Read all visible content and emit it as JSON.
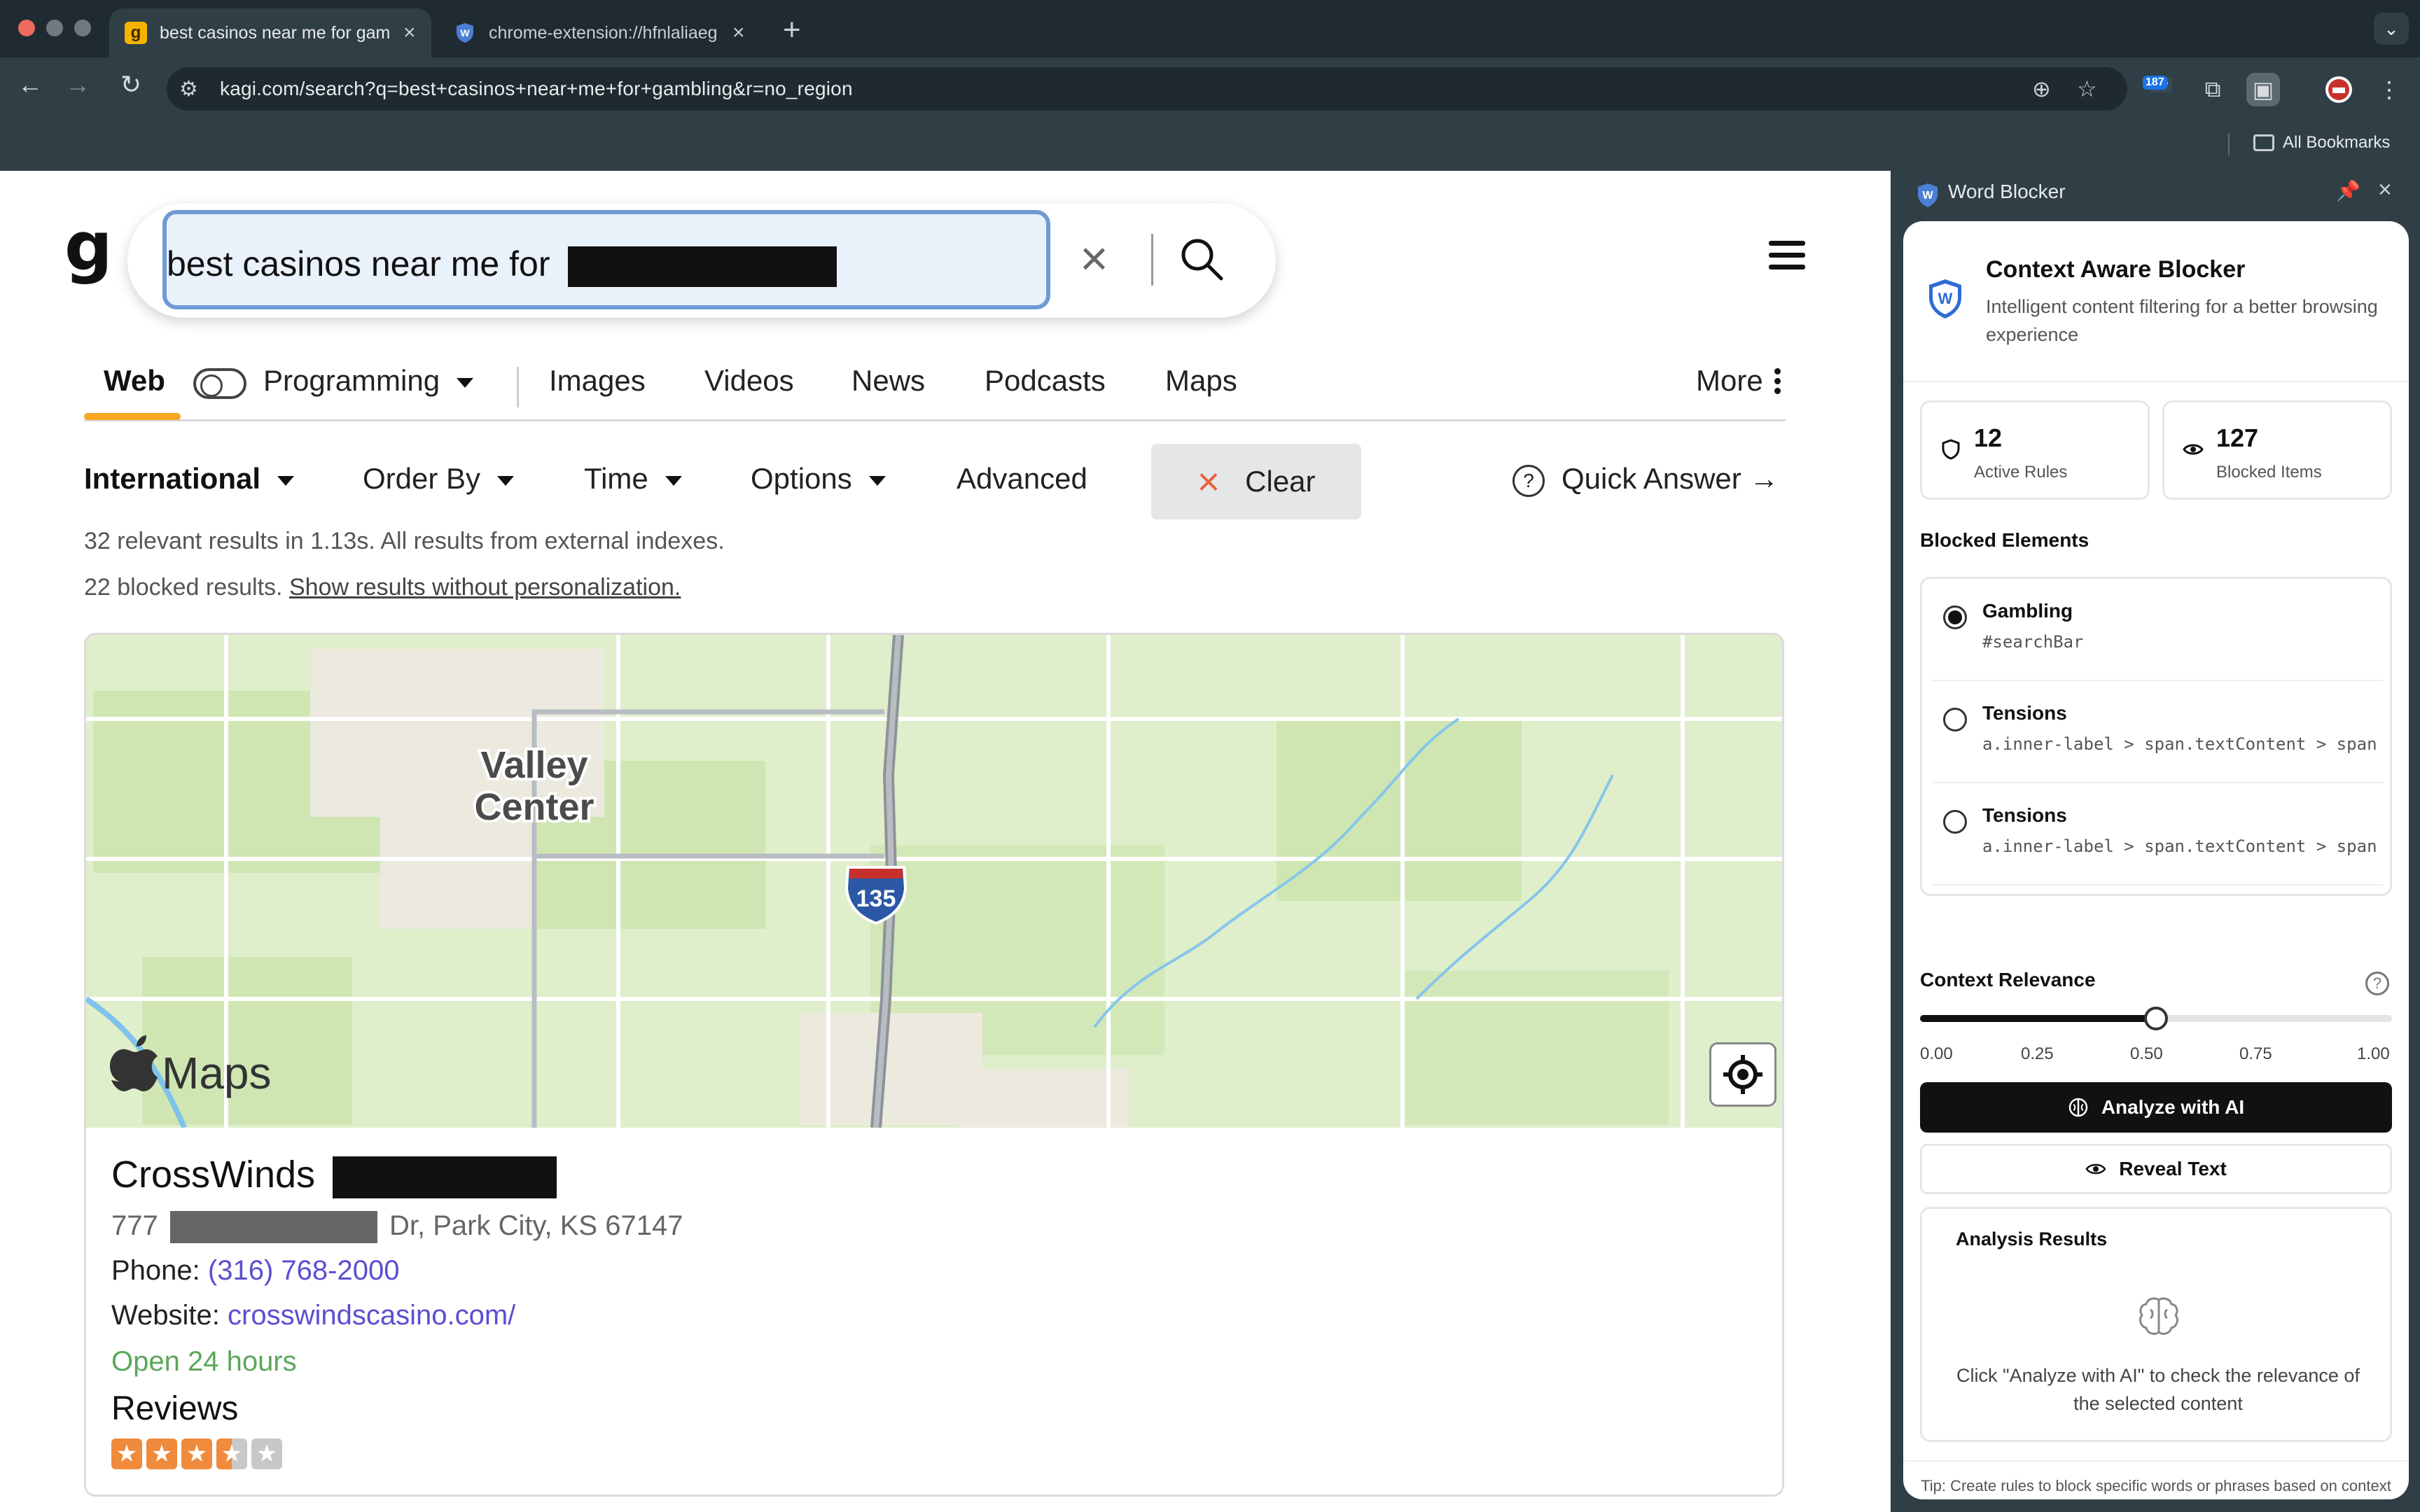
{
  "browser": {
    "tabs": [
      {
        "title": "best casinos near me for gam",
        "favicon": "kagi-g-icon",
        "active": true
      },
      {
        "title": "chrome-extension://hfnlaliaeg",
        "favicon": "word-blocker-shield-icon",
        "active": false
      }
    ],
    "url": "kagi.com/search?q=best+casinos+near+me+for+gambling&r=no_region",
    "extension_badge": "187",
    "bookmarks_label": "All Bookmarks"
  },
  "kagi": {
    "logo": "g",
    "search_query": "best casinos near me for",
    "tabs": {
      "web": "Web",
      "programming": "Programming",
      "images": "Images",
      "videos": "Videos",
      "news": "News",
      "podcasts": "Podcasts",
      "maps": "Maps",
      "more": "More"
    },
    "filters": {
      "region": "International",
      "order": "Order By",
      "time": "Time",
      "options": "Options",
      "advanced": "Advanced",
      "clear": "Clear",
      "quick_answer": "Quick Answer →"
    },
    "results_meta": "32 relevant results in 1.13s. All results from external indexes.",
    "blocked_meta": "22 blocked results.",
    "blocked_link": "Show results without personalization.",
    "map": {
      "place_label_1": "Valley",
      "place_label_2": "Center",
      "highway": "135",
      "brand": "Maps"
    },
    "business": {
      "name": "CrossWinds",
      "address_prefix": "777",
      "address_suffix": "Dr, Park City, KS 67147",
      "phone_label": "Phone:",
      "phone": "(316) 768-2000",
      "website_label": "Website:",
      "website": "crosswindscasino.com/",
      "hours": "Open 24 hours",
      "reviews_label": "Reviews",
      "rating": 3.5,
      "rating_max": 5
    }
  },
  "side_panel": {
    "title": "Word Blocker",
    "app_title": "Context Aware Blocker",
    "app_subtitle": "Intelligent content filtering for a better browsing experience",
    "stats": {
      "active_rules": "12",
      "active_rules_label": "Active Rules",
      "blocked_items": "127",
      "blocked_items_label": "Blocked Items"
    },
    "blocked_elements_title": "Blocked Elements",
    "blocked_elements": [
      {
        "name": "Gambling",
        "selector": "#searchBar",
        "selected": true
      },
      {
        "name": "Tensions",
        "selector": "a.inner-label > span.textContent > span",
        "selected": false
      },
      {
        "name": "Tensions",
        "selector": "a.inner-label > span.textContent > span",
        "selected": false
      }
    ],
    "relevance_title": "Context Relevance",
    "relevance_value": 0.5,
    "relevance_ticks": [
      "0.00",
      "0.25",
      "0.50",
      "0.75",
      "1.00"
    ],
    "analyze_label": "Analyze with AI",
    "reveal_label": "Reveal Text",
    "results_title": "Analysis Results",
    "results_message": "Click \"Analyze with AI\" to check the relevance of the selected content",
    "tip": "Tip: Create rules to block specific words or phrases based on context"
  },
  "colors": {
    "chrome_dark": "#1f2b30",
    "chrome_toolbar": "#2f3f45",
    "kagi_accent": "#f5a623",
    "link": "#5b4fd1",
    "open_green": "#5aa85a",
    "star_orange": "#f08a3c"
  }
}
